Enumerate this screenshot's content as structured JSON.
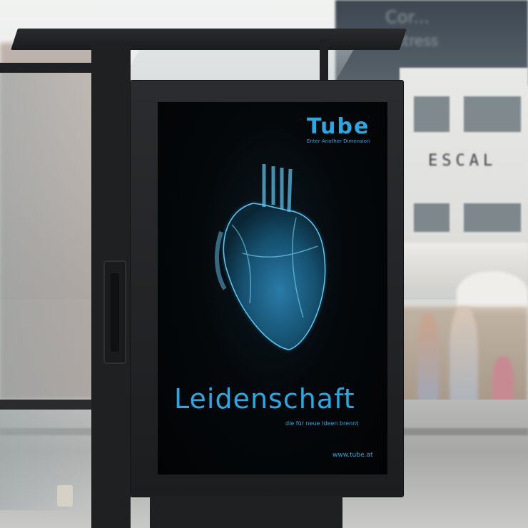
{
  "poster": {
    "logo_text": "Tube",
    "logo_tagline": "Enter Another Dimension",
    "headline": "Leidenschaft",
    "subline": "die für neue Ideen brennt",
    "url": "www.tube.at"
  },
  "background": {
    "billboard_text_1": "Cor...",
    "billboard_text_2": "stress",
    "storefront_text": "ESCAL"
  },
  "colors": {
    "accent": "#27a9e1",
    "poster_bg": "#04080b",
    "frame": "#1f2022"
  },
  "icons": {
    "heart": "heart-illustration-icon"
  }
}
